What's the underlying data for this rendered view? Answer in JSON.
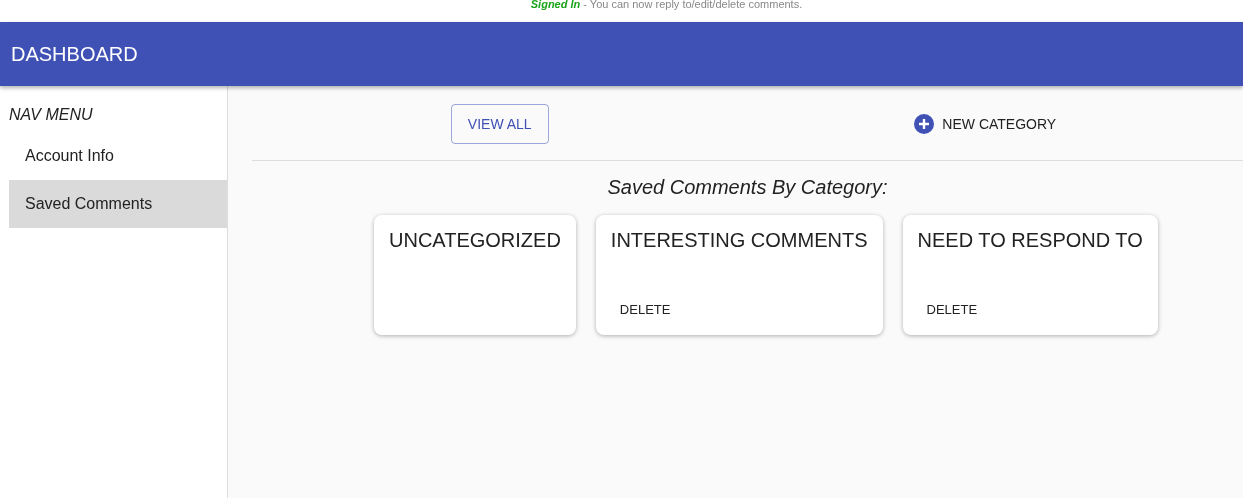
{
  "notice": {
    "status": "Signed In",
    "message": " - You can now reply to/edit/delete comments."
  },
  "header": {
    "title": "DASHBOARD"
  },
  "sidebar": {
    "heading": "NAV MENU",
    "items": [
      {
        "label": "Account Info",
        "selected": false
      },
      {
        "label": "Saved Comments",
        "selected": true
      }
    ]
  },
  "toolbar": {
    "view_all": "VIEW ALL",
    "new_category": "NEW CATEGORY"
  },
  "section_title": "Saved Comments By Category:",
  "categories": [
    {
      "name": "UNCATEGORIZED"
    },
    {
      "name": "INTERESTING COMMENTS",
      "action": "DELETE"
    },
    {
      "name": "NEED TO RESPOND TO",
      "action": "DELETE"
    }
  ]
}
